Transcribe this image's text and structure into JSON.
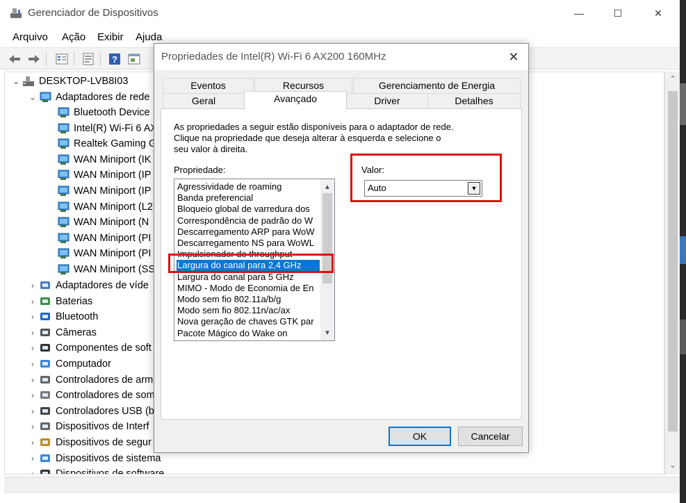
{
  "main_window": {
    "title": "Gerenciador de Dispositivos",
    "controls": {
      "minimize": "—",
      "maximize": "☐",
      "close": "✕"
    },
    "menu": [
      "Arquivo",
      "Ação",
      "Exibir",
      "Ajuda"
    ]
  },
  "tree": {
    "root": "DESKTOP-LVB8I03",
    "expanded_category": "Adaptadores de rede",
    "children": [
      "Bluetooth Device",
      "Intel(R) Wi-Fi 6 AX",
      "Realtek Gaming G",
      "WAN Miniport (IK",
      "WAN Miniport (IP",
      "WAN Miniport (IP",
      "WAN Miniport (L2",
      "WAN Miniport (N",
      "WAN Miniport (PI",
      "WAN Miniport (PI",
      "WAN Miniport (SS"
    ],
    "categories": [
      "Adaptadores de víde",
      "Baterias",
      "Bluetooth",
      "Câmeras",
      "Componentes de soft",
      "Computador",
      "Controladores de arm",
      "Controladores de som",
      "Controladores USB (b",
      "Dispositivos de Interf",
      "Dispositivos de segur",
      "Dispositivos de sistema",
      "Dispositivos de software"
    ]
  },
  "dialog": {
    "title": "Propriedades de Intel(R) Wi-Fi 6 AX200 160MHz",
    "close": "✕",
    "tabs_top": [
      "Eventos",
      "Recursos",
      "Gerenciamento de Energia"
    ],
    "tabs_bottom": [
      "Geral",
      "Avançado",
      "Driver",
      "Detalhes"
    ],
    "active_tab": "Avançado",
    "description_lines": [
      "As propriedades a seguir estão disponíveis para o adaptador de rede.",
      "Clique na propriedade que deseja alterar à esquerda e selecione o",
      "seu valor à direita."
    ],
    "property_label": "Propriedade:",
    "value_label": "Valor:",
    "properties": [
      "Agressividade de roaming",
      "Banda preferencial",
      "Bloqueio global de varredura dos",
      "Correspondência de padrão do W",
      "Descarregamento ARP para WoW",
      "Descarregamento NS para WoWL",
      "Impulsionador do throughput",
      "Largura do canal para 2,4 GHz",
      "Largura do canal para 5 GHz",
      "MIMO - Modo de Economia de En",
      "Modo sem fio 802.11a/b/g",
      "Modo sem fio 802.11n/ac/ax",
      "Nova geração de chaves GTK par",
      "Pacote Mágico do Wake on"
    ],
    "selected_index": 7,
    "value": "Auto",
    "ok_label": "OK",
    "cancel_label": "Cancelar"
  },
  "colors": {
    "selection": "#0078d7",
    "highlight_box": "#e01010"
  }
}
